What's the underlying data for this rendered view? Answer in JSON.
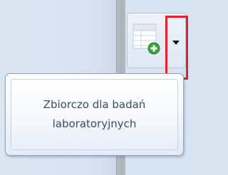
{
  "tooltip": {
    "text": "Zbiorczo dla badań laboratoryjnych"
  },
  "toolbar": {
    "button_icon": "document-add-icon",
    "dropdown_icon": "dropdown-arrow-icon"
  },
  "colors": {
    "highlight": "#e3202b",
    "add_badge": "#3aa33a"
  }
}
